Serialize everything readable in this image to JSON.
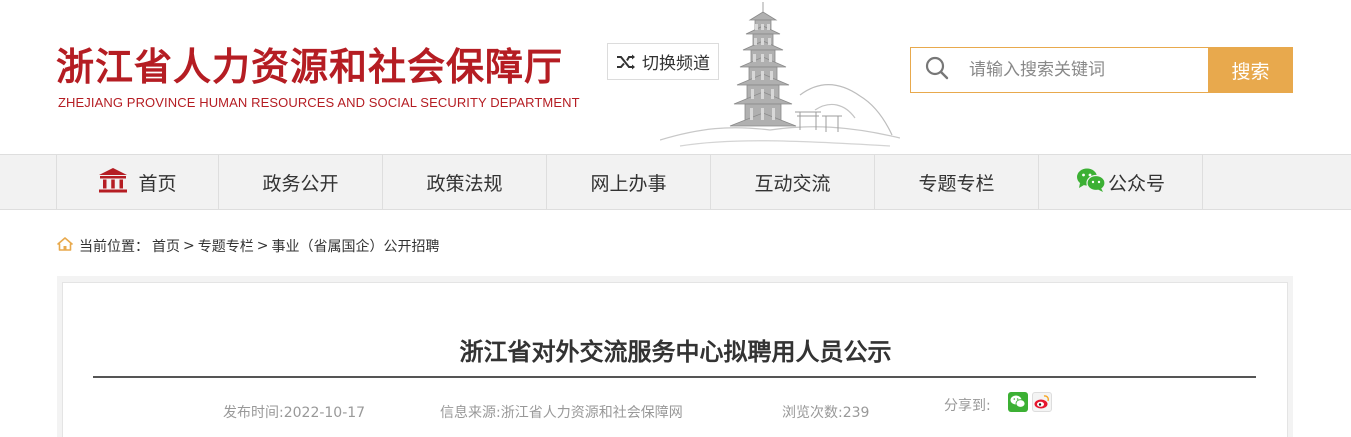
{
  "header": {
    "logo_cn": "浙江省人力资源和社会保障厅",
    "logo_en": "ZHEJIANG PROVINCE HUMAN RESOURCES AND SOCIAL SECURITY DEPARTMENT",
    "channel_label": "切换频道",
    "search_placeholder": "请输入搜索关键词",
    "search_button": "搜索"
  },
  "nav": {
    "items": [
      {
        "label": "首页",
        "icon": "home-building-icon"
      },
      {
        "label": "政务公开"
      },
      {
        "label": "政策法规"
      },
      {
        "label": "网上办事"
      },
      {
        "label": "互动交流"
      },
      {
        "label": "专题专栏"
      },
      {
        "label": "公众号",
        "icon": "wechat-icon"
      }
    ]
  },
  "breadcrumb": {
    "prefix": "当前位置：",
    "items": [
      "首页",
      "专题专栏",
      "事业（省属国企）公开招聘"
    ],
    "separator": ">"
  },
  "article": {
    "title": "浙江省对外交流服务中心拟聘用人员公示",
    "publish_time": "发布时间:2022-10-17",
    "source": "信息来源:浙江省人力资源和社会保障网",
    "views": "浏览次数:239",
    "share_label": "分享到:"
  },
  "colors": {
    "brand_red": "#b51d23",
    "accent_orange": "#e8a94d",
    "wechat_green": "#3cb034",
    "weibo_red": "#e6162d"
  }
}
